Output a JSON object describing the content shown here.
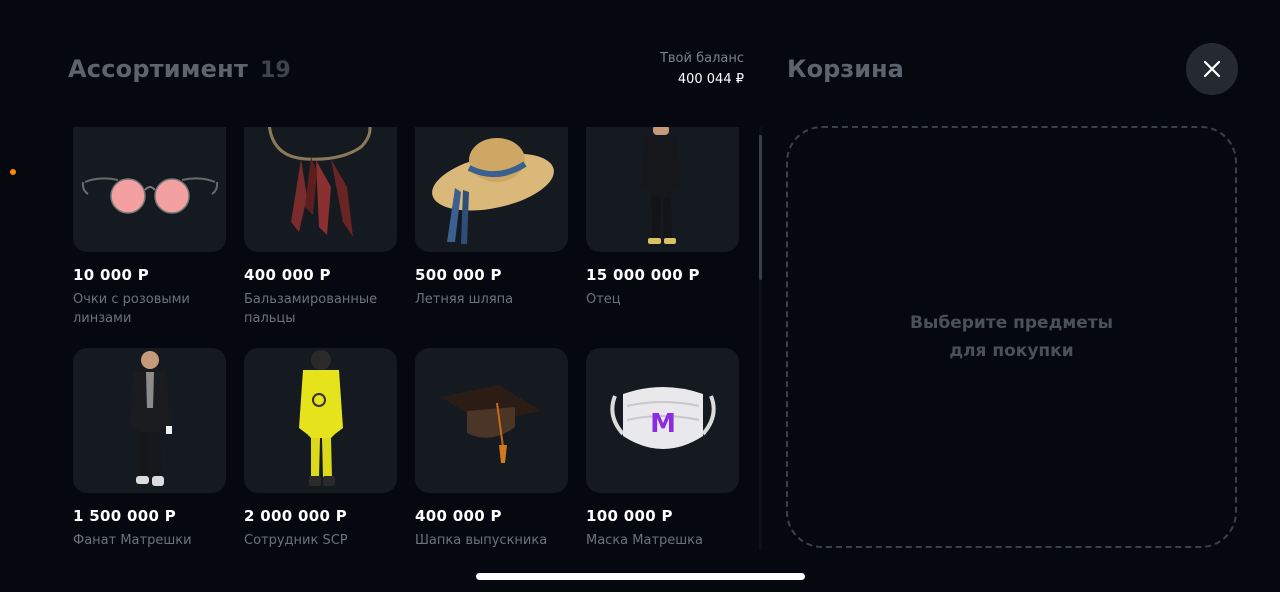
{
  "header": {
    "title": "Ассортимент",
    "count": "19",
    "balance_label": "Твой баланс",
    "balance_value": "400 044 ₽",
    "cart_title": "Корзина"
  },
  "items": [
    {
      "price": "10 000 Р",
      "name": "Очки с розовыми линзами",
      "icon": "pink-glasses"
    },
    {
      "price": "400 000 Р",
      "name": "Бальзамированные пальцы",
      "icon": "finger-necklace"
    },
    {
      "price": "500 000 Р",
      "name": "Летняя шляпа",
      "icon": "straw-hat"
    },
    {
      "price": "15 000 000 Р",
      "name": "Отец",
      "icon": "character-black-outfit"
    },
    {
      "price": "1 500 000 Р",
      "name": "Фанат Матрешки",
      "icon": "character-jacket"
    },
    {
      "price": "2 000 000 Р",
      "name": "Сотрудник SCP",
      "icon": "hazmat-suit"
    },
    {
      "price": "400 000 Р",
      "name": "Шапка выпускника",
      "icon": "graduation-cap"
    },
    {
      "price": "100 000 Р",
      "name": "Маска Матрешка",
      "icon": "face-mask"
    }
  ],
  "cart": {
    "empty_line1": "Выберите предметы",
    "empty_line2": "для покупки"
  },
  "mask_letter": "M",
  "colors": {
    "background": "#05080e",
    "card": "#151a20",
    "accent_dot": "#ff8a00",
    "muted_title": "#5d646e",
    "mask_logo": "#8b2be2"
  }
}
